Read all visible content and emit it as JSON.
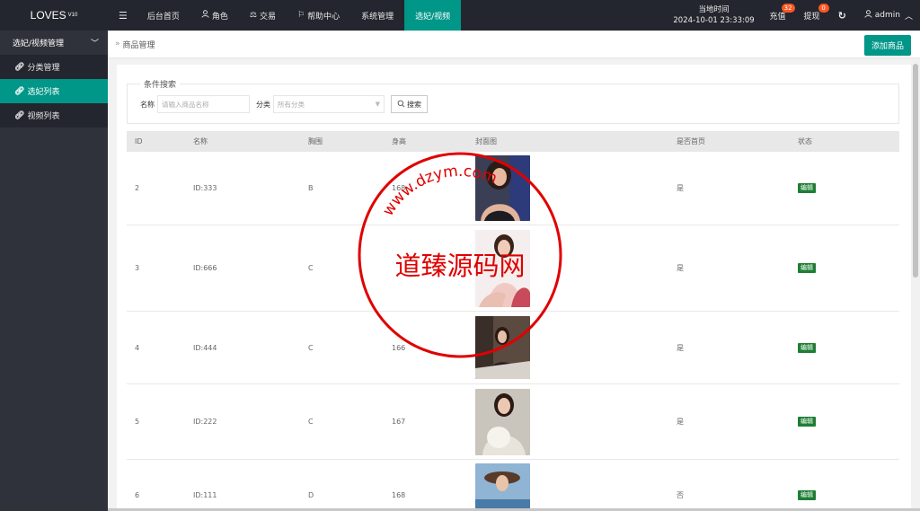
{
  "app": {
    "name": "LOVES",
    "version": "V10"
  },
  "nav": {
    "menu_icon": "hamburger-icon",
    "items": [
      {
        "label": "后台首页",
        "icon": ""
      },
      {
        "label": "角色",
        "icon": "user-icon"
      },
      {
        "label": "交易",
        "icon": "scale-icon"
      },
      {
        "label": "帮助中心",
        "icon": "flag-icon"
      },
      {
        "label": "系统管理",
        "icon": ""
      },
      {
        "label": "选妃/视频",
        "icon": "",
        "active": true
      }
    ]
  },
  "top_right": {
    "clock_label": "当地时间",
    "clock_value": "2024-10-01 23:33:09",
    "recharge": {
      "label": "充值",
      "badge": "32"
    },
    "withdraw": {
      "label": "提现",
      "badge": "0"
    },
    "refresh_icon": "refresh-icon",
    "user": {
      "name": "admin",
      "icon": "user-icon"
    }
  },
  "sidebar": {
    "group": {
      "label": "选妃/视频管理",
      "icon": "chevron-down-icon"
    },
    "items": [
      {
        "label": "分类管理",
        "icon": "link-icon"
      },
      {
        "label": "选妃列表",
        "icon": "link-icon",
        "active": true
      },
      {
        "label": "视频列表",
        "icon": "link-icon"
      }
    ]
  },
  "breadcrumb": {
    "current": "商品管理"
  },
  "add_button": "添加商品",
  "search": {
    "legend": "条件搜索",
    "name_label": "名称",
    "name_placeholder": "请输入商品名称",
    "category_label": "分类",
    "category_value": "所有分类",
    "button": "搜索"
  },
  "table": {
    "headers": [
      "ID",
      "名称",
      "胸围",
      "身高",
      "封面图",
      "是否首页",
      "状态"
    ],
    "rows": [
      {
        "id": "2",
        "name": "ID:333",
        "chest": "B",
        "height": "168",
        "home": "是",
        "status": "编辑"
      },
      {
        "id": "3",
        "name": "ID:666",
        "chest": "C",
        "height": "",
        "home": "是",
        "status": "编辑"
      },
      {
        "id": "4",
        "name": "ID:444",
        "chest": "C",
        "height": "166",
        "home": "是",
        "status": "编辑"
      },
      {
        "id": "5",
        "name": "ID:222",
        "chest": "C",
        "height": "167",
        "home": "是",
        "status": "编辑"
      },
      {
        "id": "6",
        "name": "ID:111",
        "chest": "D",
        "height": "168",
        "home": "否",
        "status": "编辑"
      }
    ]
  },
  "stamp": {
    "title": "道臻源码网",
    "ring_text": "www.dzym.com",
    "color": "#e00000"
  },
  "colors": {
    "accent": "#009688",
    "topbar": "#23262e",
    "sidebar": "#2f323a",
    "badge": "#ff5722",
    "status": "#1e7e34"
  }
}
